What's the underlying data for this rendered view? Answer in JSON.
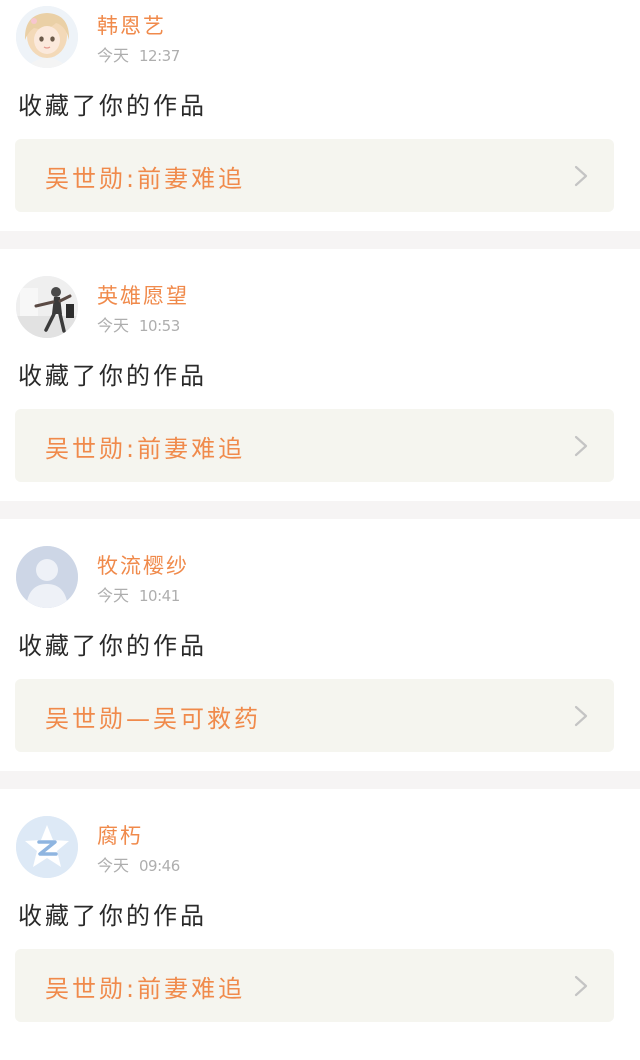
{
  "feed": {
    "items": [
      {
        "username": "韩恩艺",
        "day": "今天",
        "time": "12:37",
        "action": "收藏了你的作品",
        "work_title": "吴世勋:前妻难追",
        "avatar_icon": "anime-girl-avatar"
      },
      {
        "username": "英雄愿望",
        "day": "今天",
        "time": "10:53",
        "action": "收藏了你的作品",
        "work_title": "吴世勋:前妻难追",
        "avatar_icon": "dancer-photo-avatar"
      },
      {
        "username": "牧流樱纱",
        "day": "今天",
        "time": "10:41",
        "action": "收藏了你的作品",
        "work_title": "吴世勋—吴可救药",
        "avatar_icon": "default-user-avatar"
      },
      {
        "username": "腐朽",
        "day": "今天",
        "time": "09:46",
        "action": "收藏了你的作品",
        "work_title": "吴世勋:前妻难追",
        "avatar_icon": "z-logo-avatar"
      }
    ]
  },
  "colors": {
    "accent": "#f08a4b",
    "card_bg": "#f5f5ef",
    "separator": "#f6f4f4",
    "meta": "#aeaeae",
    "text": "#2a2a2a"
  }
}
